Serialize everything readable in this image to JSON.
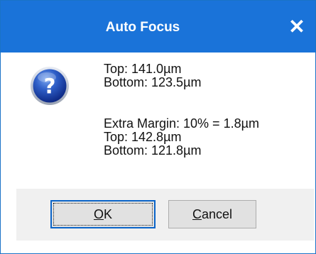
{
  "window": {
    "title": "Auto Focus",
    "close_glyph": "✕",
    "accent_color": "#1a73d9"
  },
  "icon": {
    "name": "question-icon",
    "glyph": "?"
  },
  "message": {
    "line1": "Top: 141.0µm",
    "line2": "Bottom: 123.5µm",
    "line3": "Extra Margin: 10% = 1.8µm",
    "line4": "Top: 142.8µm",
    "line5": "Bottom: 121.8µm"
  },
  "buttons": {
    "ok": {
      "mnemonic": "O",
      "rest": "K"
    },
    "cancel": {
      "mnemonic": "C",
      "rest": "ancel"
    }
  }
}
